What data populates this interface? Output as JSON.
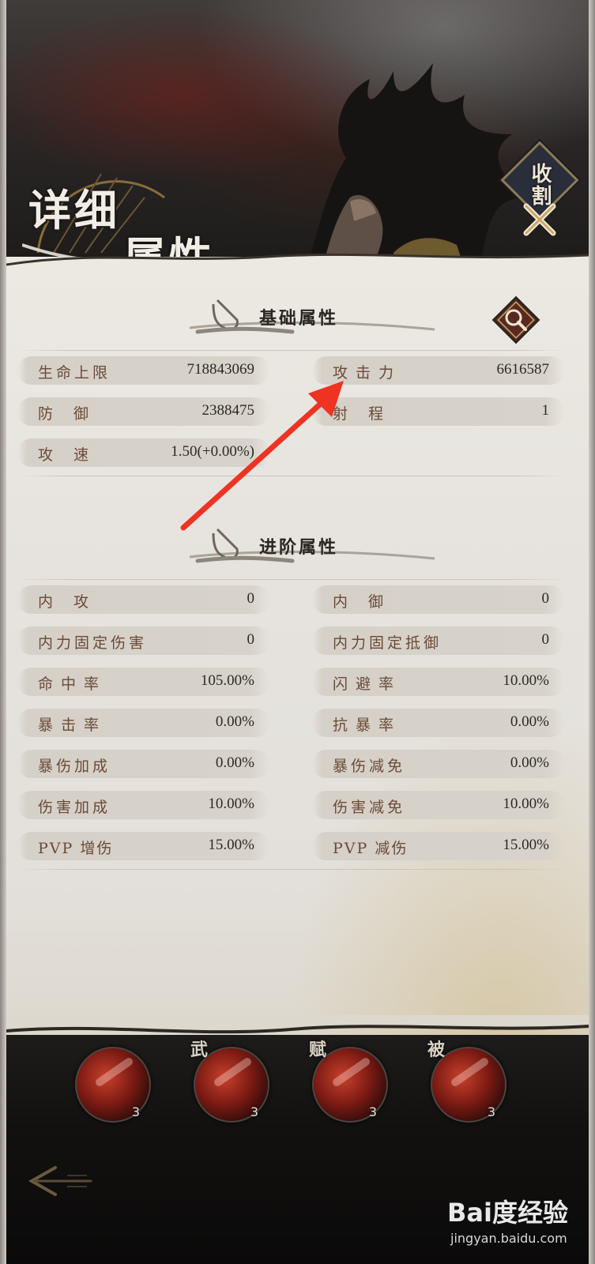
{
  "title": {
    "line1": "详细",
    "line2": "属性"
  },
  "close_button": {
    "label": "收割"
  },
  "sections": {
    "basic": {
      "title": "基础属性"
    },
    "advanced": {
      "title": "进阶属性"
    }
  },
  "basic_stats": [
    {
      "name": "生命上限",
      "value": "718843069"
    },
    {
      "name": "攻击力",
      "value": "6616587"
    },
    {
      "name": "防御",
      "value": "2388475"
    },
    {
      "name": "射程",
      "value": "1"
    },
    {
      "name": "攻速",
      "value": "1.50(+0.00%)"
    }
  ],
  "advanced_stats": [
    {
      "name": "内攻",
      "value": "0"
    },
    {
      "name": "内御",
      "value": "0"
    },
    {
      "name": "内力固定伤害",
      "value": "0"
    },
    {
      "name": "内力固定抵御",
      "value": "0"
    },
    {
      "name": "命中率",
      "value": "105.00%"
    },
    {
      "name": "闪避率",
      "value": "10.00%"
    },
    {
      "name": "暴击率",
      "value": "0.00%"
    },
    {
      "name": "抗暴率",
      "value": "0.00%"
    },
    {
      "name": "暴伤加成",
      "value": "0.00%"
    },
    {
      "name": "暴伤减免",
      "value": "0.00%"
    },
    {
      "name": "伤害加成",
      "value": "10.00%"
    },
    {
      "name": "伤害减免",
      "value": "10.00%"
    },
    {
      "name": "PVP 增伤",
      "value": "15.00%"
    },
    {
      "name": "PVP 减伤",
      "value": "15.00%"
    }
  ],
  "skills": [
    {
      "tag": "",
      "count": "3"
    },
    {
      "tag": "武",
      "count": "3"
    },
    {
      "tag": "赋",
      "count": "3"
    },
    {
      "tag": "被",
      "count": "3"
    }
  ],
  "watermark": {
    "text": "Bai度经验",
    "sub": "jingyan.baidu.com"
  },
  "colors": {
    "label": "#6b4a37",
    "value": "#2c2a27",
    "panel": "#e6e3de",
    "arrow": "#ee3322"
  }
}
